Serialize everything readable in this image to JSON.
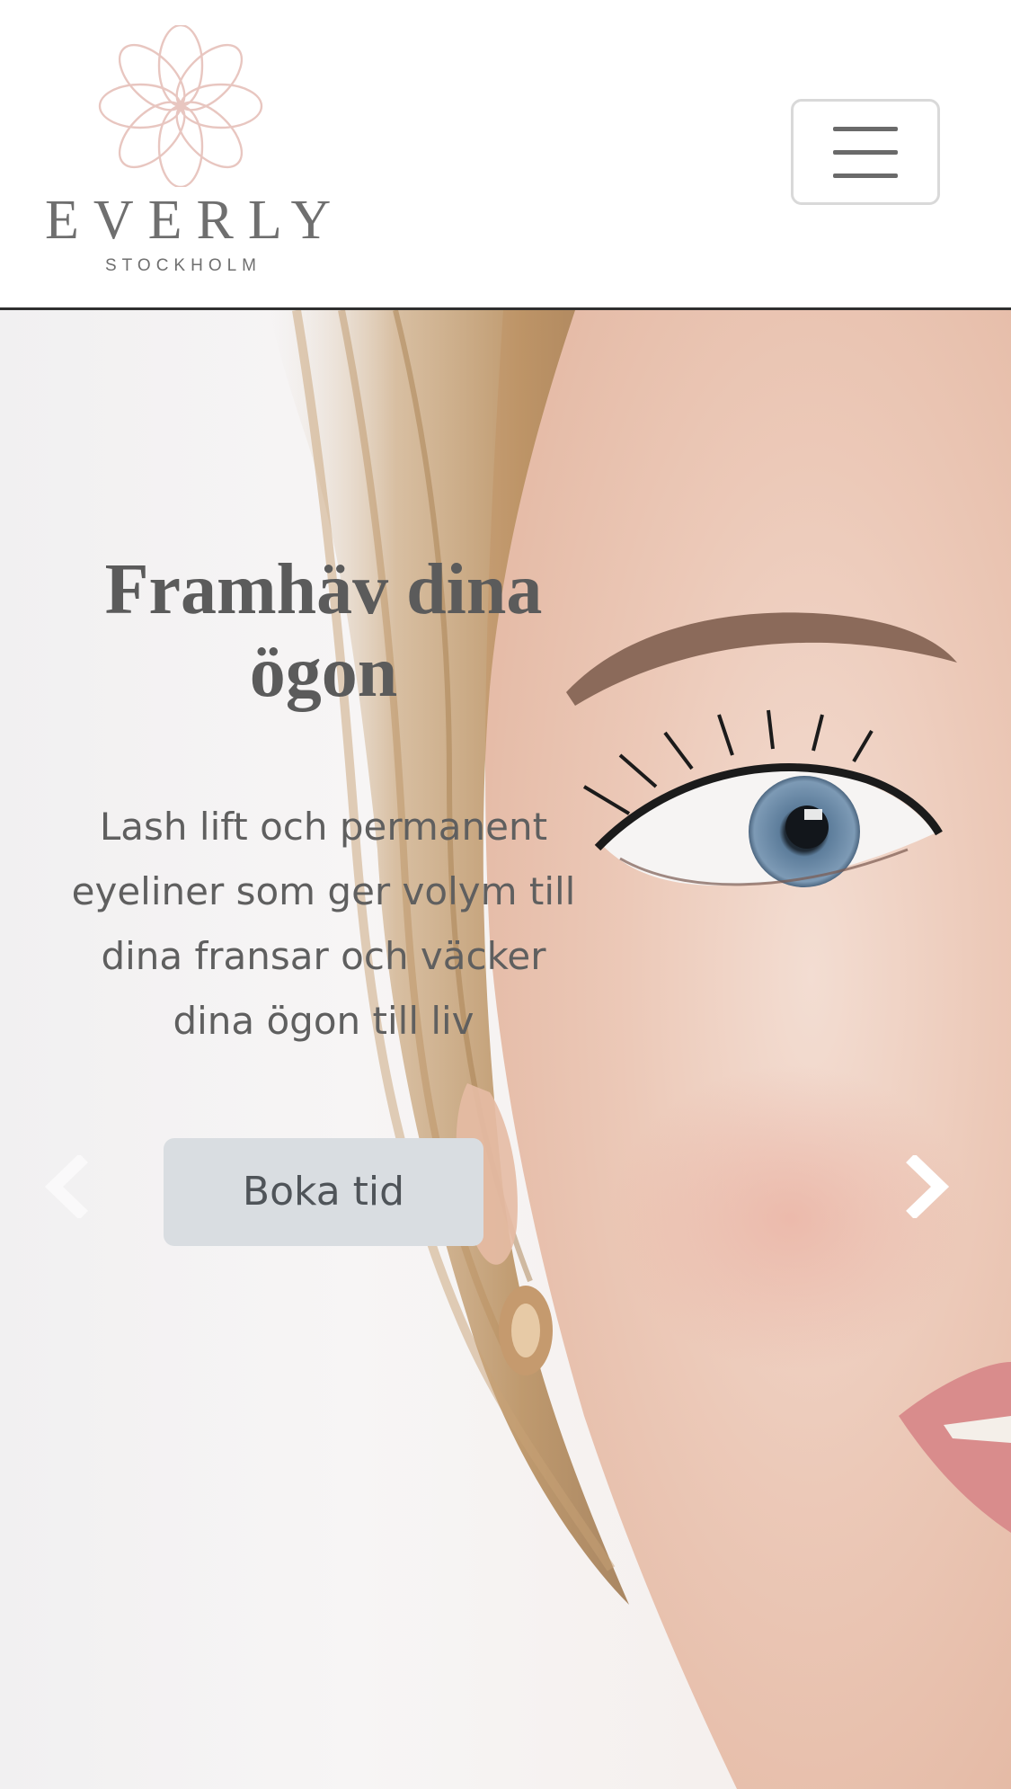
{
  "brand": {
    "name": "EVERLY",
    "location": "STOCKHOLM",
    "logo_icon": "flower-logo-icon",
    "accent_color": "#e8c6c0"
  },
  "nav": {
    "menu_icon": "hamburger-menu-icon"
  },
  "hero": {
    "title_line1": "Framhäv dina",
    "title_line2": "ögon",
    "text_line1": "Lash lift och permanent",
    "text_line2": "eyeliner som ger volym till",
    "text_line3": "dina fransar och väcker",
    "text_line4": "dina ögon till liv",
    "cta_label": "Boka tid",
    "prev_icon": "chevron-left-icon",
    "next_icon": "chevron-right-icon"
  }
}
